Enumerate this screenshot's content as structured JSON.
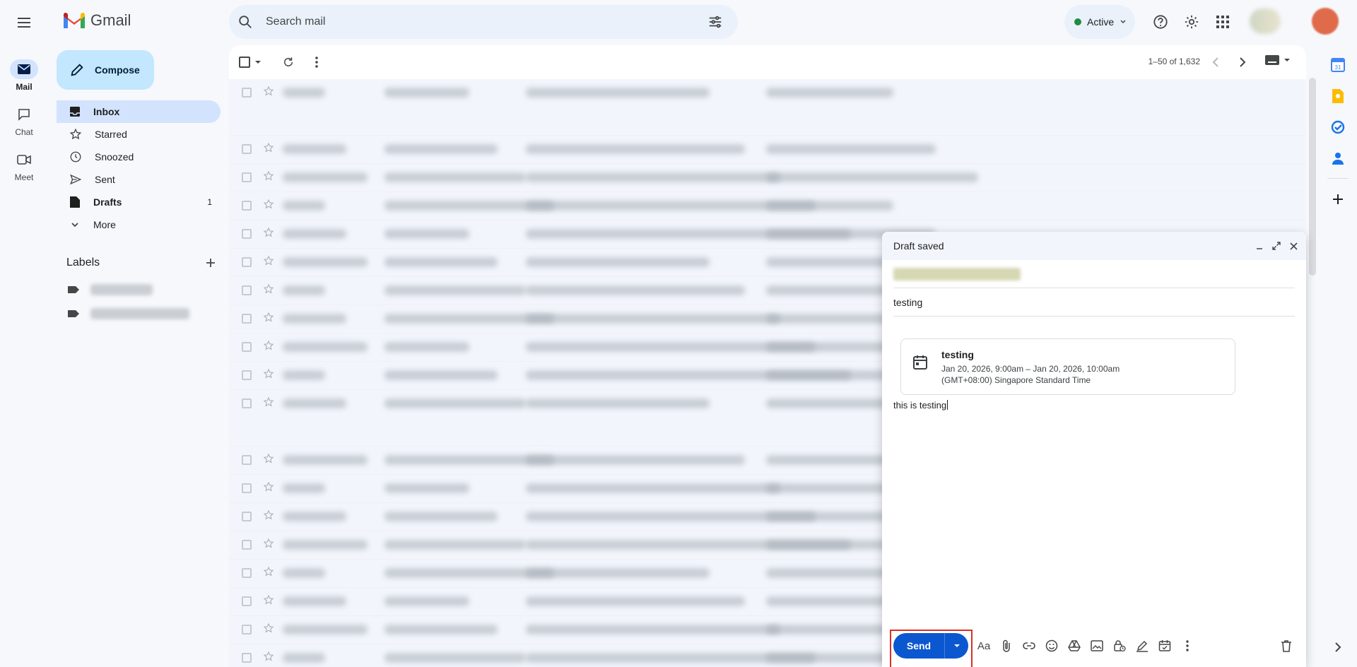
{
  "app": {
    "name": "Gmail"
  },
  "rail": {
    "items": [
      {
        "label": "Mail",
        "icon": "mail-icon",
        "active": true
      },
      {
        "label": "Chat",
        "icon": "chat-icon",
        "active": false
      },
      {
        "label": "Meet",
        "icon": "video-icon",
        "active": false
      }
    ]
  },
  "search": {
    "placeholder": "Search mail"
  },
  "status": {
    "label": "Active",
    "color": "#1e8e3e"
  },
  "sidebar": {
    "compose_label": "Compose",
    "items": [
      {
        "label": "Inbox",
        "icon": "inbox-icon",
        "count": ""
      },
      {
        "label": "Starred",
        "icon": "star-icon",
        "count": ""
      },
      {
        "label": "Snoozed",
        "icon": "clock-icon",
        "count": ""
      },
      {
        "label": "Sent",
        "icon": "send-icon",
        "count": ""
      },
      {
        "label": "Drafts",
        "icon": "draft-icon",
        "count": "1"
      },
      {
        "label": "More",
        "icon": "chevron-down-icon",
        "count": ""
      }
    ],
    "labels_title": "Labels"
  },
  "toolbar": {
    "pagination": "1–50 of 1,632"
  },
  "compose_window": {
    "title": "Draft saved",
    "subject": "testing",
    "event": {
      "title": "testing",
      "time": "Jan 20, 2026, 9:00am – Jan 20, 2026, 10:00am",
      "timezone": "(GMT+08:00) Singapore Standard Time"
    },
    "body": "this is testing",
    "send_label": "Send",
    "tools": [
      "format-text-icon",
      "attach-icon",
      "link-icon",
      "emoji-icon",
      "drive-icon",
      "image-icon",
      "lock-clock-icon",
      "signature-icon",
      "schedule-icon",
      "more-vertical-icon"
    ]
  },
  "colors": {
    "accent": "#0b57d0",
    "highlight": "#d93025",
    "active_nav": "#d3e3fd",
    "compose_bg": "#c2e7ff"
  }
}
